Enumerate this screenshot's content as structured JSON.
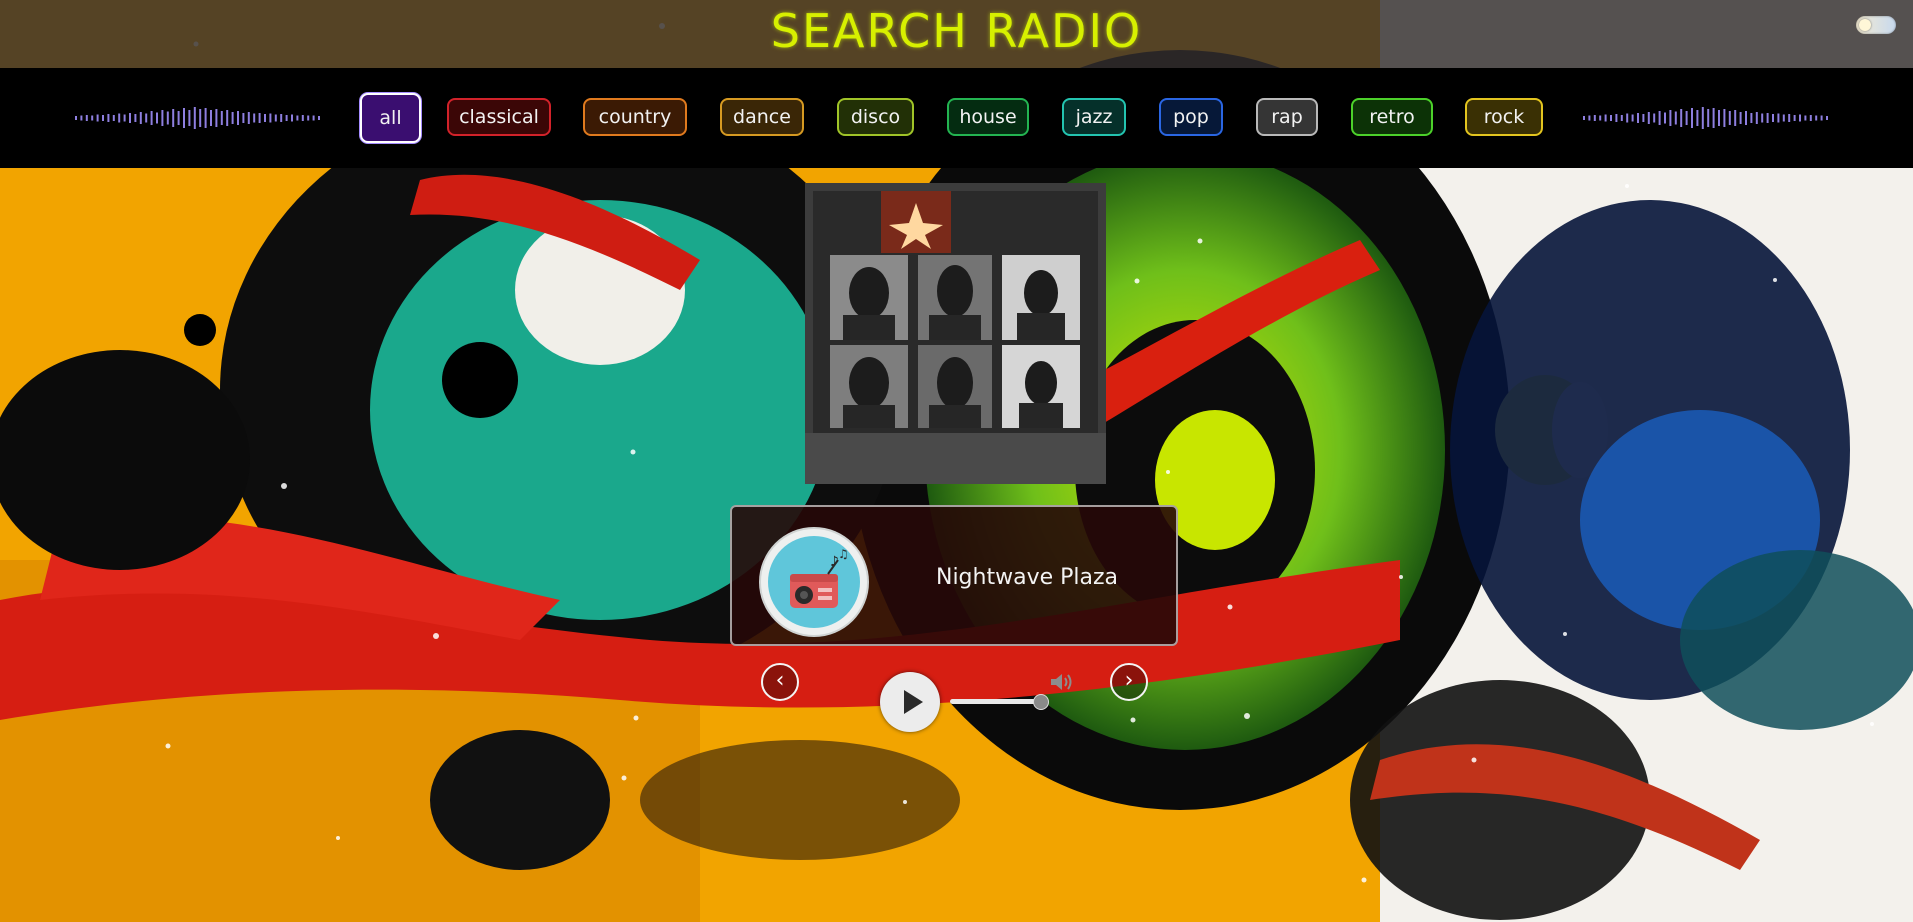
{
  "app": {
    "title": "SEARCH RADIO"
  },
  "genres": [
    {
      "label": "all",
      "active": true,
      "color": "#a58cff",
      "fill": "#3a0e70"
    },
    {
      "label": "classical",
      "active": false,
      "color": "#d2222a",
      "fill": "#3b0606"
    },
    {
      "label": "country",
      "active": false,
      "color": "#e07a1e",
      "fill": "#3b1a04"
    },
    {
      "label": "dance",
      "active": false,
      "color": "#d69a22",
      "fill": "#3a2606"
    },
    {
      "label": "disco",
      "active": false,
      "color": "#a0c428",
      "fill": "#223006"
    },
    {
      "label": "house",
      "active": false,
      "color": "#23b451",
      "fill": "#042c11"
    },
    {
      "label": "jazz",
      "active": false,
      "color": "#23c4b0",
      "fill": "#05302a"
    },
    {
      "label": "pop",
      "active": false,
      "color": "#2a66e3",
      "fill": "#061838"
    },
    {
      "label": "rap",
      "active": false,
      "color": "#b9b9b9",
      "fill": "#353535"
    },
    {
      "label": "retro",
      "active": false,
      "color": "#4cd12a",
      "fill": "#0c3206"
    },
    {
      "label": "rock",
      "active": false,
      "color": "#e3c51f",
      "fill": "#3a3004"
    }
  ],
  "station": {
    "name": "Nightwave Plaza"
  },
  "player": {
    "state": "paused",
    "volume": 0.95
  },
  "icons": {
    "prev": "chevron-left-icon",
    "next": "chevron-right-icon",
    "play": "play-icon",
    "volume": "volume-icon",
    "radio": "radio-icon",
    "wave": "audio-wave-icon",
    "toggle": "theme-toggle-icon"
  }
}
